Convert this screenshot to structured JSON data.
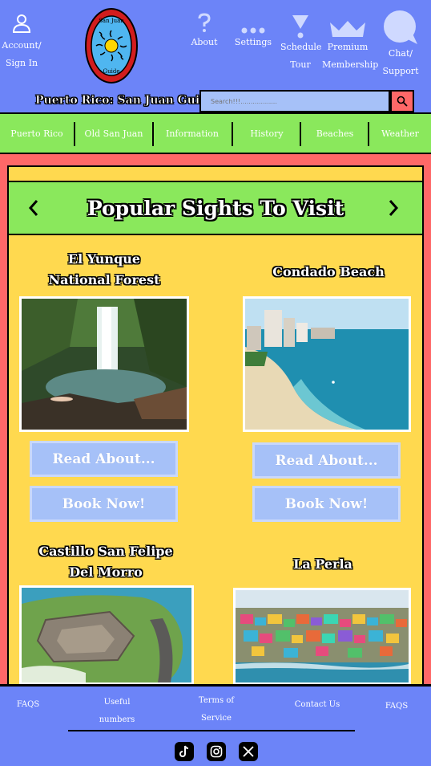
{
  "header": {
    "nav_buttons": [
      {
        "label": "Account/\nSign In",
        "icon": "person-icon"
      },
      {
        "label": "About",
        "icon": "question-icon"
      },
      {
        "label": "Settings",
        "icon": "dots-icon"
      },
      {
        "label": "Schedule\nTour",
        "icon": "hourglass-icon"
      },
      {
        "label": "Premium\nMembership",
        "icon": "crown-icon"
      },
      {
        "label": "Chat/\nSupport",
        "icon": "chat-bubble-icon"
      }
    ],
    "logo": {
      "top_text": "San Juan",
      "bottom_text": "Guide"
    },
    "site_title": "Puerto Rico: San Juan Guide",
    "search_placeholder": "Search!!!.................."
  },
  "nav": {
    "items": [
      "Puerto Rico",
      "Old San Juan",
      "Information",
      "History",
      "Beaches",
      "Weather"
    ]
  },
  "carousel": {
    "title": "Popular Sights To Visit",
    "sights": [
      {
        "name_line1": "El Yunque",
        "name_line2": "National Forest",
        "read_label": "Read About...",
        "book_label": "Book Now!"
      },
      {
        "name_line1": "Condado Beach",
        "name_line2": "",
        "read_label": "Read About...",
        "book_label": "Book Now!"
      },
      {
        "name_line1": "Castillo San Felipe",
        "name_line2": "Del Morro"
      },
      {
        "name_line1": "La Perla",
        "name_line2": ""
      }
    ]
  },
  "footer": {
    "links": [
      "FAQS",
      "Useful\nnumbers",
      "Terms of\nService",
      "Contact Us",
      "FAQS"
    ],
    "social": [
      "tiktok-icon",
      "instagram-icon",
      "x-icon"
    ]
  },
  "colors": {
    "header_blue": "#6c84f8",
    "nav_green": "#8ae85c",
    "frame_red": "#ff6868",
    "panel_yellow": "#ffd94f",
    "button_blue": "#a6c1f8"
  }
}
